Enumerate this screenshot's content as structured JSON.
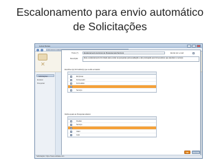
{
  "slide": {
    "title_line1": "Escalonamento para envio automático",
    "title_line2": "de Solicitações"
  },
  "window": {
    "title": "Lotus Notes",
    "address": "http://www.solitata.com/fim/solitata/solitataescalonamento.nsf",
    "statusbar": "Solicitação: https://www.solitata.com"
  },
  "sidebar": {
    "tab_label": "Solicitações",
    "items": [
      "Escalon",
      "Pesquisar"
    ]
  },
  "dialog": {
    "field1_label": "Título (*):",
    "field1_value": "Escalonamento de Envio de Pesquisa para Serviços",
    "field1_right_label": "Enviar por e-mail",
    "field2_label": "Descrição:",
    "field2_value": "Esse escalonamento foi criado para enviar as pesquisas para avaliação e dar pontuação aos fornecedores que atendem o serviço",
    "section1_label": "Escolha o(s) formulário(s) que serão enviados:",
    "list1": {
      "header": "",
      "rows": [
        {
          "label": "Empresa",
          "checked": false,
          "selected": false
        },
        {
          "label": "Fornecedor",
          "checked": false,
          "selected": false
        },
        {
          "label": "Formulário",
          "checked": false,
          "selected": false
        },
        {
          "label": "",
          "checked": true,
          "selected": true
        },
        {
          "label": "Serviço",
          "checked": false,
          "selected": false
        }
      ]
    },
    "section2_label": "Defina quais as Pesquisas abaixo:",
    "list2": {
      "header": "",
      "rows": [
        {
          "label": "Pedido",
          "checked": false,
          "selected": false
        },
        {
          "label": "Serviço",
          "checked": true,
          "selected": false
        },
        {
          "label": "",
          "checked": true,
          "selected": true
        },
        {
          "label": "Valor",
          "checked": true,
          "selected": false
        },
        {
          "label": "Loja",
          "checked": true,
          "selected": false
        }
      ]
    },
    "ok_label": "OK",
    "cancel_label": "Cancelar"
  },
  "colors": {
    "selected_row": "#f5a13a",
    "accent_orange": "#e58a1f",
    "window_chrome": "#dfe8f2"
  }
}
